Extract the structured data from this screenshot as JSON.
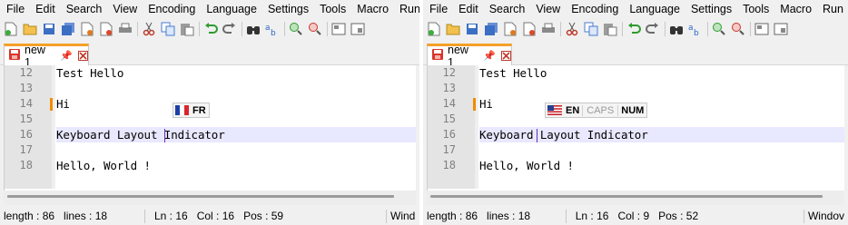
{
  "panes": [
    {
      "menu": [
        "File",
        "Edit",
        "Search",
        "View",
        "Encoding",
        "Language",
        "Settings",
        "Tools",
        "Macro",
        "Run"
      ],
      "tab": {
        "label": "new 1"
      },
      "lines": [
        {
          "num": "12",
          "text": "Test Hello"
        },
        {
          "num": "13",
          "text": ""
        },
        {
          "num": "14",
          "text": "Hi"
        },
        {
          "num": "15",
          "text": ""
        },
        {
          "num": "16",
          "text": "Keyboard Layout Indicator"
        },
        {
          "num": "17",
          "text": ""
        },
        {
          "num": "18",
          "text": "Hello, World !"
        }
      ],
      "indicator": {
        "lang": "FR",
        "flag": "france-flag-icon"
      },
      "status": {
        "length": "length : 86",
        "lines": "lines : 18",
        "ln": "Ln : 16",
        "col": "Col : 16",
        "pos": "Pos : 59",
        "eol": "Wind"
      }
    },
    {
      "menu": [
        "File",
        "Edit",
        "Search",
        "View",
        "Encoding",
        "Language",
        "Settings",
        "Tools",
        "Macro",
        "Run"
      ],
      "tab": {
        "label": "new 1"
      },
      "lines": [
        {
          "num": "12",
          "text": "Test Hello"
        },
        {
          "num": "13",
          "text": ""
        },
        {
          "num": "14",
          "text": "Hi"
        },
        {
          "num": "15",
          "text": ""
        },
        {
          "num": "16",
          "text": "Keyboard Layout Indicator"
        },
        {
          "num": "17",
          "text": ""
        },
        {
          "num": "18",
          "text": "Hello, World !"
        }
      ],
      "indicator": {
        "lang": "EN",
        "caps": "CAPS",
        "num": "NUM",
        "flag": "us-flag-icon"
      },
      "status": {
        "length": "length : 86",
        "lines": "lines : 18",
        "ln": "Ln : 16",
        "col": "Col : 9",
        "pos": "Pos : 52",
        "eol": "Windov"
      }
    }
  ],
  "colors": {
    "tab_accent": "#f5a027",
    "current_line": "#e8e8ff",
    "change_marker": "#f08c00",
    "caret": "#6a2fb0"
  }
}
